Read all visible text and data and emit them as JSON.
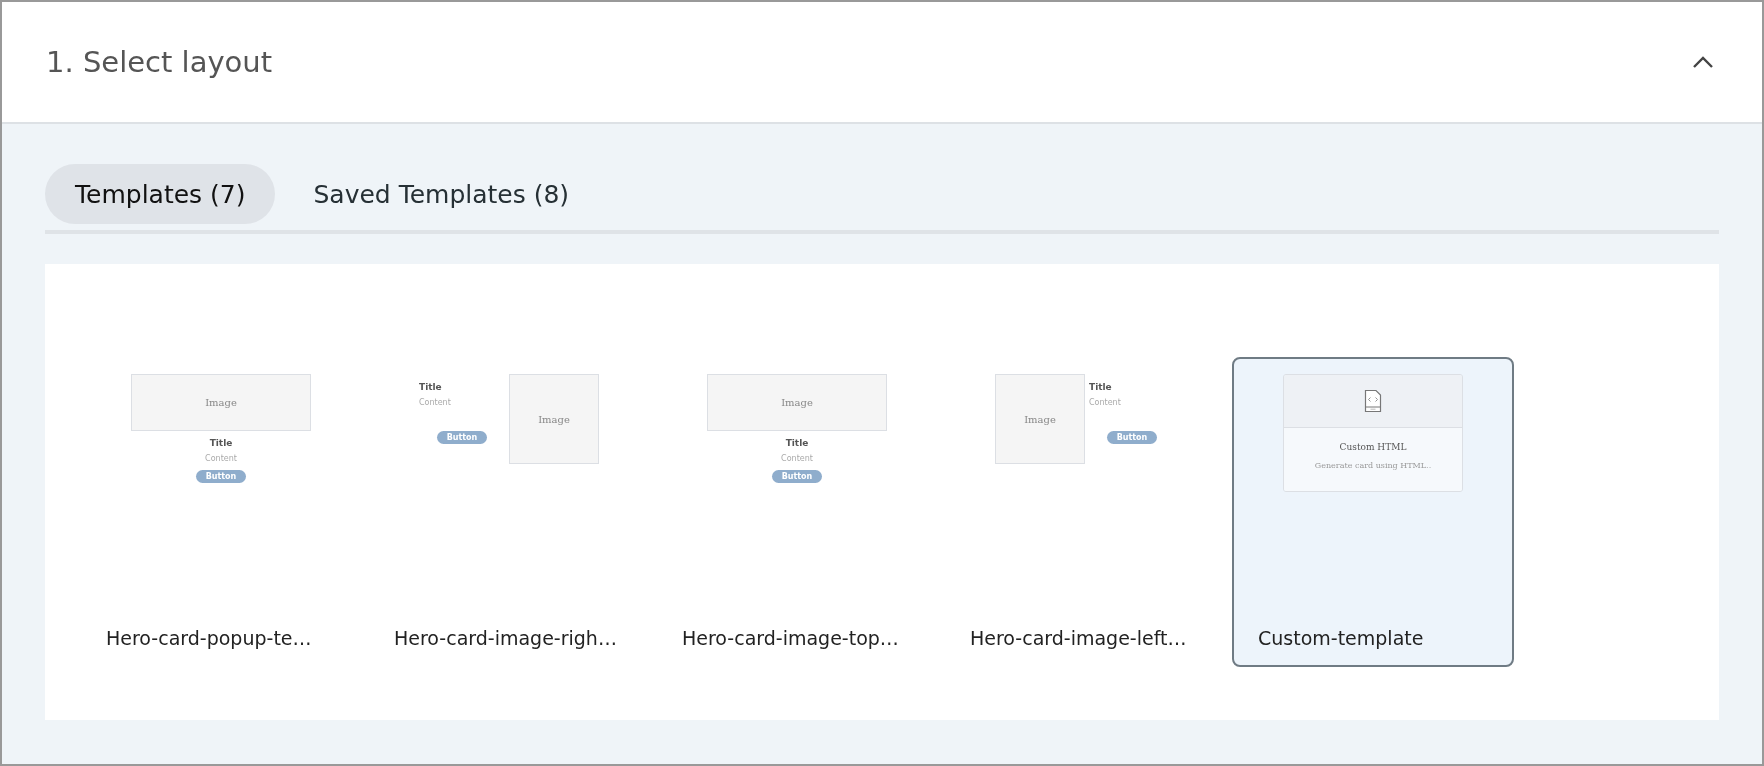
{
  "section": {
    "title": "1. Select layout",
    "expanded": true
  },
  "tabs": [
    {
      "label": "Templates (7)",
      "selected": true
    },
    {
      "label": "Saved Templates (8)",
      "selected": false
    }
  ],
  "templates": [
    {
      "kind": "image-top",
      "name": "Hero-card-popup-te…",
      "selected": false,
      "preview": {
        "image": "Image",
        "title": "Title",
        "content": "Content",
        "button": "Button"
      }
    },
    {
      "kind": "image-right",
      "name": "Hero-card-image-righ…",
      "selected": false,
      "preview": {
        "image": "Image",
        "title": "Title",
        "content": "Content",
        "button": "Button"
      }
    },
    {
      "kind": "image-top",
      "name": "Hero-card-image-top…",
      "selected": false,
      "preview": {
        "image": "Image",
        "title": "Title",
        "content": "Content",
        "button": "Button"
      }
    },
    {
      "kind": "image-left",
      "name": "Hero-card-image-left…",
      "selected": false,
      "preview": {
        "image": "Image",
        "title": "Title",
        "content": "Content",
        "button": "Button"
      }
    },
    {
      "kind": "custom",
      "name": "Custom-template",
      "selected": true,
      "preview": {
        "title": "Custom HTML",
        "content": "Generate card using HTML.."
      }
    }
  ]
}
